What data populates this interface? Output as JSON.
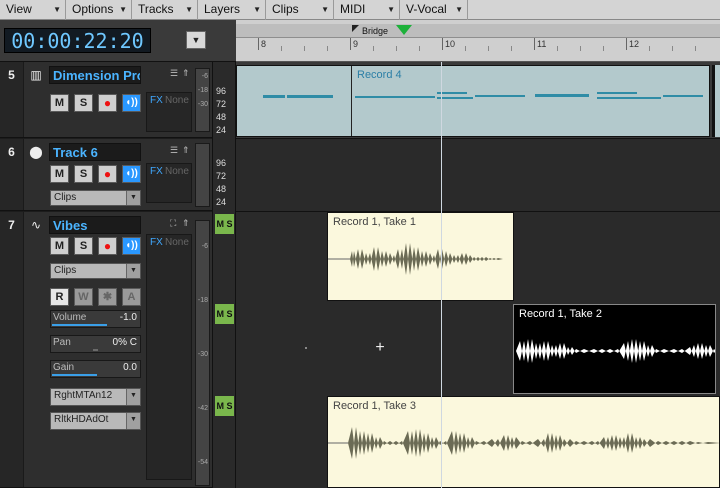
{
  "menus": [
    {
      "label": "View"
    },
    {
      "label": "Options"
    },
    {
      "label": "Tracks"
    },
    {
      "label": "Layers"
    },
    {
      "label": "Clips"
    },
    {
      "label": "MIDI"
    },
    {
      "label": "V-Vocal"
    }
  ],
  "transport": {
    "time": "00:00:22:20"
  },
  "ruler": {
    "measures": [
      "8",
      "9",
      "10",
      "11",
      "12"
    ],
    "marker": "Bridge"
  },
  "tracks": [
    {
      "number": "5",
      "name": "Dimension Pro",
      "icon": "synth-icon",
      "mute": "M",
      "solo": "S",
      "fx": "FX",
      "fx_value": "None",
      "meter_labels": [
        "-6",
        "-18",
        "-30"
      ],
      "velocities": [
        "96",
        "72",
        "48",
        "24"
      ]
    },
    {
      "number": "6",
      "name": "Track 6",
      "icon": "midi-icon",
      "mute": "M",
      "solo": "S",
      "fx": "FX",
      "fx_value": "None",
      "dropdown": "Clips",
      "velocities": [
        "96",
        "72",
        "48",
        "24"
      ]
    },
    {
      "number": "7",
      "name": "Vibes",
      "icon": "waveform-icon",
      "mute": "M",
      "solo": "S",
      "fx": "FX",
      "fx_value": "None",
      "dropdown": "Clips",
      "rwx": [
        "R",
        "W",
        "✱",
        "A"
      ],
      "volume": {
        "label": "Volume",
        "value": "-1.0",
        "level": 0.62
      },
      "pan": {
        "label": "Pan",
        "value": "0% C",
        "level": 0.5
      },
      "gain": {
        "label": "Gain",
        "value": "0.0",
        "level": 0.5
      },
      "input": "RghtMTAn12",
      "output": "RltkHDAdOt",
      "meter_labels": [
        "-6",
        "-18",
        "-30",
        "-42",
        "-54"
      ],
      "ms_label": "M S"
    }
  ],
  "clips": [
    {
      "name": "Record 4",
      "kind": "midi"
    },
    {
      "name": "Record 1, Take 1",
      "kind": "audio"
    },
    {
      "name": "Record 1, Take 2",
      "kind": "audio-selected"
    },
    {
      "name": "Record 1, Take 3",
      "kind": "audio"
    }
  ]
}
